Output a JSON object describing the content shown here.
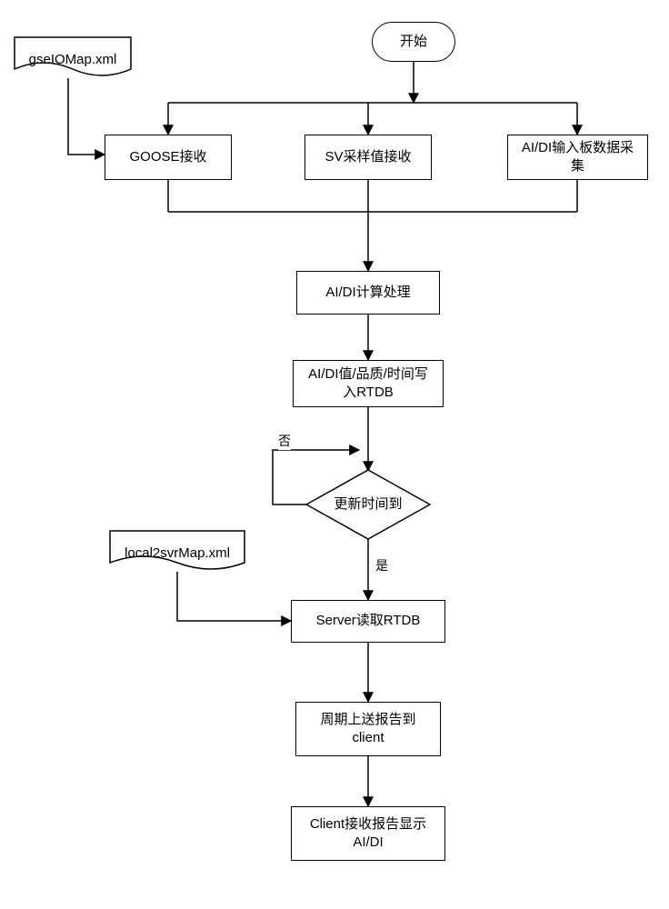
{
  "diagram": {
    "start": "开始",
    "file_gse": "gseIOMap.xml",
    "goose_rx": "GOOSE接收",
    "sv_rx": "SV采样值接收",
    "aidi_board": "AI/DI输入板数据采\n集",
    "aidi_calc": "AI/DI计算处理",
    "aidi_write": "AI/DI值/品质/时间写\n入RTDB",
    "decision": "更新时间到",
    "dec_no": "否",
    "dec_yes": "是",
    "file_local": "local2svrMap.xml",
    "server_read": "Server读取RTDB",
    "periodic": "周期上送报告到\nclient",
    "client_show": "Client接收报告显示\nAI/DI"
  }
}
